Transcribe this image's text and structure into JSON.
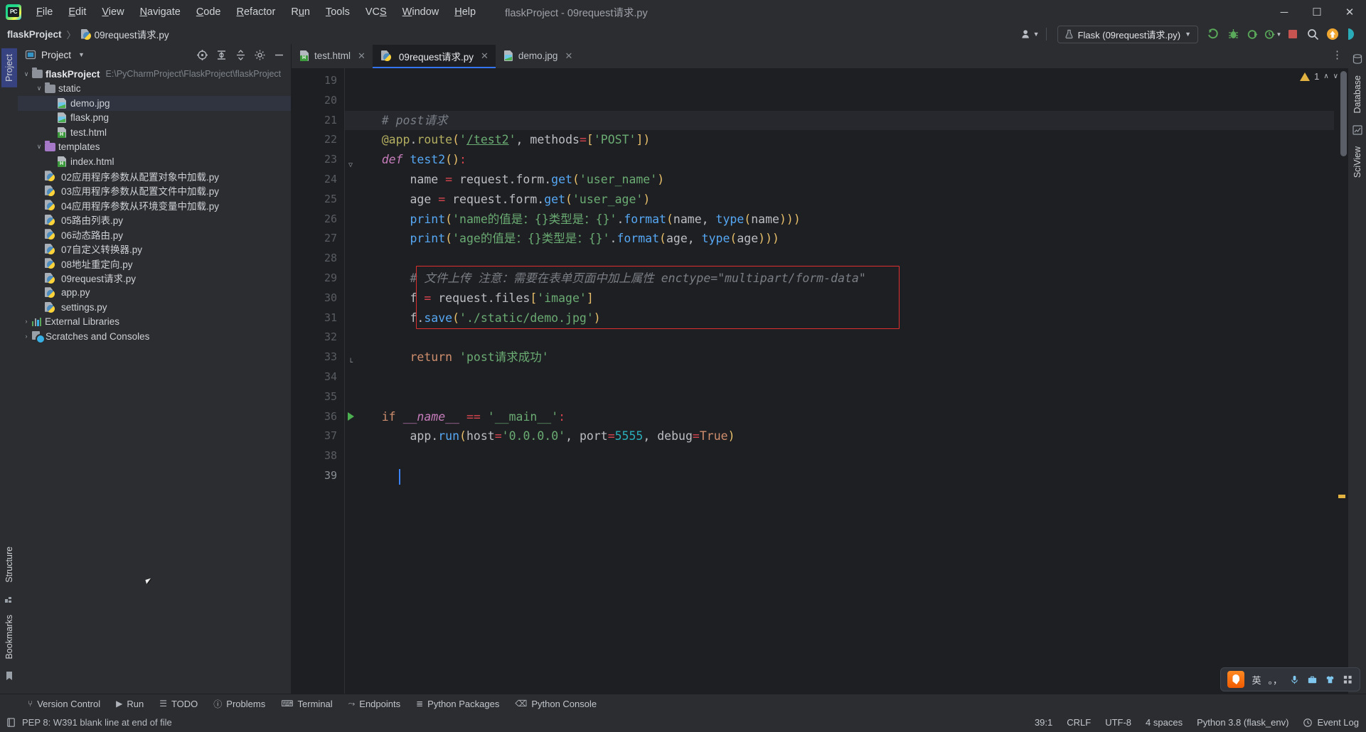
{
  "app": {
    "logo_icon": "pycharm-logo-icon",
    "window_title": "flaskProject - 09request请求.py",
    "menu": [
      {
        "mnemonic": "F",
        "rest": "ile"
      },
      {
        "mnemonic": "E",
        "rest": "dit"
      },
      {
        "mnemonic": "V",
        "rest": "iew"
      },
      {
        "mnemonic": "N",
        "rest": "avigate"
      },
      {
        "mnemonic": "C",
        "rest": "ode"
      },
      {
        "mnemonic": "R",
        "rest": "efactor"
      },
      {
        "mnemonic": "Ru",
        "rest": "n",
        "pre": true
      },
      {
        "mnemonic": "T",
        "rest": "ools"
      },
      {
        "mnemonic": "VCS",
        "rest": ""
      },
      {
        "mnemonic": "W",
        "rest": "indow"
      },
      {
        "mnemonic": "H",
        "rest": "elp"
      }
    ],
    "window_controls": {
      "minimize": "—",
      "maximize": "❐",
      "close": "✕"
    }
  },
  "breadcrumb": {
    "project": "flaskProject",
    "separator": "〉",
    "file": "09request请求.py",
    "file_icon": "python-file-icon"
  },
  "toolbar": {
    "account_icon": "user-account-icon",
    "run_config": {
      "icon": "flask-config-icon",
      "label": "Flask (09request请求.py)",
      "chevron": "▼"
    },
    "buttons": [
      {
        "name": "run-button",
        "icon": "run-icon",
        "glyph": "▶"
      },
      {
        "name": "debug-button",
        "icon": "debug-bug-icon",
        "glyph": "🐞"
      },
      {
        "name": "run-with-coverage-button",
        "icon": "coverage-icon",
        "glyph": "◑"
      },
      {
        "name": "profile-button",
        "icon": "profiler-clock-icon",
        "glyph": "◴"
      },
      {
        "name": "stop-button",
        "icon": "stop-square-icon",
        "glyph": "■"
      },
      {
        "name": "search-everywhere-button",
        "icon": "search-icon",
        "glyph": "🔍"
      },
      {
        "name": "updates-button",
        "icon": "update-arrow-icon",
        "glyph": "↑"
      },
      {
        "name": "ai-assistant-button",
        "icon": "ai-assistant-icon",
        "glyph": "◗"
      }
    ]
  },
  "left_strip": {
    "tabs": [
      {
        "label": "Project",
        "icon": "project-tab-icon",
        "active": true
      },
      {
        "label": "Structure",
        "icon": "structure-tab-icon",
        "active": false
      },
      {
        "label": "Bookmarks",
        "icon": "bookmarks-tab-icon",
        "active": false
      }
    ]
  },
  "right_strip": {
    "tabs": [
      {
        "label": "Database",
        "icon": "database-tab-icon"
      },
      {
        "label": "SciView",
        "icon": "sciview-tab-icon"
      }
    ]
  },
  "project_panel": {
    "title": "Project",
    "title_icon": "project-panel-icon",
    "chevron": "▼",
    "actions": [
      {
        "name": "select-opened-file-button",
        "icon": "crosshair-target-icon",
        "glyph": "⊕"
      },
      {
        "name": "expand-all-button",
        "icon": "expand-all-icon",
        "glyph": "⤑"
      },
      {
        "name": "collapse-all-button",
        "icon": "collapse-all-icon",
        "glyph": "⤒"
      },
      {
        "name": "settings-button",
        "icon": "gear-icon",
        "glyph": "⚙"
      },
      {
        "name": "hide-button",
        "icon": "minimize-icon",
        "glyph": "—"
      }
    ],
    "tree": [
      {
        "label": "flaskProject",
        "path": "E:\\PyCharmProject\\FlaskProject\\flaskProject",
        "icon": "folder-icon",
        "indent": 0,
        "twisty": "∨",
        "bold": true,
        "selected": false
      },
      {
        "label": "static",
        "icon": "folder-icon",
        "indent": 1,
        "twisty": "∨",
        "selected": false
      },
      {
        "label": "demo.jpg",
        "icon": "image-file-icon",
        "indent": 2,
        "twisty": "",
        "selected": true
      },
      {
        "label": "flask.png",
        "icon": "image-file-icon",
        "indent": 2,
        "twisty": "",
        "selected": false
      },
      {
        "label": "test.html",
        "icon": "html-file-icon",
        "indent": 2,
        "twisty": "",
        "selected": false
      },
      {
        "label": "templates",
        "icon": "folder-purple-icon",
        "indent": 1,
        "twisty": "∨",
        "selected": false
      },
      {
        "label": "index.html",
        "icon": "html-file-icon",
        "indent": 2,
        "twisty": "",
        "selected": false
      },
      {
        "label": "02应用程序参数从配置对象中加载.py",
        "icon": "python-file-icon",
        "indent": 1,
        "twisty": "",
        "selected": false
      },
      {
        "label": "03应用程序参数从配置文件中加载.py",
        "icon": "python-file-icon",
        "indent": 1,
        "twisty": "",
        "selected": false
      },
      {
        "label": "04应用程序参数从环境变量中加载.py",
        "icon": "python-file-icon",
        "indent": 1,
        "twisty": "",
        "selected": false
      },
      {
        "label": "05路由列表.py",
        "icon": "python-file-icon",
        "indent": 1,
        "twisty": "",
        "selected": false
      },
      {
        "label": "06动态路由.py",
        "icon": "python-file-icon",
        "indent": 1,
        "twisty": "",
        "selected": false
      },
      {
        "label": "07自定义转换器.py",
        "icon": "python-file-icon",
        "indent": 1,
        "twisty": "",
        "selected": false
      },
      {
        "label": "08地址重定向.py",
        "icon": "python-file-icon",
        "indent": 1,
        "twisty": "",
        "selected": false
      },
      {
        "label": "09request请求.py",
        "icon": "python-file-icon",
        "indent": 1,
        "twisty": "",
        "selected": false
      },
      {
        "label": "app.py",
        "icon": "python-file-icon",
        "indent": 1,
        "twisty": "",
        "selected": false
      },
      {
        "label": "settings.py",
        "icon": "python-file-icon",
        "indent": 1,
        "twisty": "",
        "selected": false
      },
      {
        "label": "External Libraries",
        "icon": "external-libraries-icon",
        "indent": 0,
        "twisty": "›",
        "selected": false
      },
      {
        "label": "Scratches and Consoles",
        "icon": "scratches-icon",
        "indent": 0,
        "twisty": "›",
        "selected": false
      }
    ]
  },
  "editor": {
    "tabs": [
      {
        "label": "test.html",
        "icon": "html-file-icon",
        "active": false,
        "close": "✕"
      },
      {
        "label": "09request请求.py",
        "icon": "python-file-icon",
        "active": true,
        "close": "✕"
      },
      {
        "label": "demo.jpg",
        "icon": "image-file-icon",
        "active": false,
        "close": "✕"
      }
    ],
    "more_tabs_icon": "more-vertical-icon",
    "first_line_number": 19,
    "lines": [
      {
        "n": 19,
        "tokens": []
      },
      {
        "n": 20,
        "tokens": []
      },
      {
        "n": 21,
        "hl": true,
        "tokens": [
          {
            "t": "    ",
            "c": "t-pl"
          },
          {
            "t": "# post请求",
            "c": "t-cmt"
          }
        ]
      },
      {
        "n": 22,
        "tokens": [
          {
            "t": "    ",
            "c": "t-pl"
          },
          {
            "t": "@app",
            "c": "t-deco"
          },
          {
            "t": ".",
            "c": "t-pl"
          },
          {
            "t": "route",
            "c": "t-deco"
          },
          {
            "t": "(",
            "c": "t-par"
          },
          {
            "t": "'",
            "c": "t-str"
          },
          {
            "t": "/test2",
            "c": "t-url"
          },
          {
            "t": "'",
            "c": "t-str"
          },
          {
            "t": ", ",
            "c": "t-pl"
          },
          {
            "t": "methods",
            "c": "t-pl"
          },
          {
            "t": "=",
            "c": "t-op"
          },
          {
            "t": "[",
            "c": "t-par"
          },
          {
            "t": "'POST'",
            "c": "t-str"
          },
          {
            "t": "]",
            "c": "t-par"
          },
          {
            "t": ")",
            "c": "t-par"
          }
        ]
      },
      {
        "n": 23,
        "fold": "▽",
        "tokens": [
          {
            "t": "    ",
            "c": "t-pl"
          },
          {
            "t": "def",
            "c": "t-kw2"
          },
          {
            "t": " ",
            "c": "t-pl"
          },
          {
            "t": "test2",
            "c": "t-def"
          },
          {
            "t": "(",
            "c": "t-par"
          },
          {
            "t": ")",
            "c": "t-par"
          },
          {
            "t": ":",
            "c": "t-op"
          }
        ]
      },
      {
        "n": 24,
        "tokens": [
          {
            "t": "        name ",
            "c": "t-pl"
          },
          {
            "t": "=",
            "c": "t-op"
          },
          {
            "t": " request.form.",
            "c": "t-pl"
          },
          {
            "t": "get",
            "c": "t-fn"
          },
          {
            "t": "(",
            "c": "t-par"
          },
          {
            "t": "'user_name'",
            "c": "t-str"
          },
          {
            "t": ")",
            "c": "t-par"
          }
        ]
      },
      {
        "n": 25,
        "tokens": [
          {
            "t": "        age ",
            "c": "t-pl"
          },
          {
            "t": "=",
            "c": "t-op"
          },
          {
            "t": " request.form.",
            "c": "t-pl"
          },
          {
            "t": "get",
            "c": "t-fn"
          },
          {
            "t": "(",
            "c": "t-par"
          },
          {
            "t": "'user_age'",
            "c": "t-str"
          },
          {
            "t": ")",
            "c": "t-par"
          }
        ]
      },
      {
        "n": 26,
        "tokens": [
          {
            "t": "        ",
            "c": "t-pl"
          },
          {
            "t": "print",
            "c": "t-fn"
          },
          {
            "t": "(",
            "c": "t-par"
          },
          {
            "t": "'name的值是：{}类型是：{}'",
            "c": "t-str"
          },
          {
            "t": ".",
            "c": "t-pl"
          },
          {
            "t": "format",
            "c": "t-fn"
          },
          {
            "t": "(",
            "c": "t-par"
          },
          {
            "t": "name, ",
            "c": "t-pl"
          },
          {
            "t": "type",
            "c": "t-fn"
          },
          {
            "t": "(",
            "c": "t-par"
          },
          {
            "t": "name",
            "c": "t-pl"
          },
          {
            "t": ")))",
            "c": "t-par"
          }
        ]
      },
      {
        "n": 27,
        "tokens": [
          {
            "t": "        ",
            "c": "t-pl"
          },
          {
            "t": "print",
            "c": "t-fn"
          },
          {
            "t": "(",
            "c": "t-par"
          },
          {
            "t": "'age的值是：{}类型是：{}'",
            "c": "t-str"
          },
          {
            "t": ".",
            "c": "t-pl"
          },
          {
            "t": "format",
            "c": "t-fn"
          },
          {
            "t": "(",
            "c": "t-par"
          },
          {
            "t": "age, ",
            "c": "t-pl"
          },
          {
            "t": "type",
            "c": "t-fn"
          },
          {
            "t": "(",
            "c": "t-par"
          },
          {
            "t": "age",
            "c": "t-pl"
          },
          {
            "t": ")))",
            "c": "t-par"
          }
        ]
      },
      {
        "n": 28,
        "tokens": []
      },
      {
        "n": 29,
        "tokens": [
          {
            "t": "        ",
            "c": "t-pl"
          },
          {
            "t": "# 文件上传 注意：需要在表单页面中加上属性 enctype=\"multipart/form-data\"",
            "c": "t-cmt"
          }
        ]
      },
      {
        "n": 30,
        "tokens": [
          {
            "t": "        f ",
            "c": "t-pl"
          },
          {
            "t": "=",
            "c": "t-op"
          },
          {
            "t": " request.files",
            "c": "t-pl"
          },
          {
            "t": "[",
            "c": "t-par"
          },
          {
            "t": "'image'",
            "c": "t-str"
          },
          {
            "t": "]",
            "c": "t-par"
          }
        ]
      },
      {
        "n": 31,
        "tokens": [
          {
            "t": "        f.",
            "c": "t-pl"
          },
          {
            "t": "save",
            "c": "t-fn"
          },
          {
            "t": "(",
            "c": "t-par"
          },
          {
            "t": "'./static/demo.jpg'",
            "c": "t-str"
          },
          {
            "t": ")",
            "c": "t-par"
          }
        ]
      },
      {
        "n": 32,
        "tokens": []
      },
      {
        "n": 33,
        "fold": "└",
        "tokens": [
          {
            "t": "        ",
            "c": "t-pl"
          },
          {
            "t": "return",
            "c": "t-kw"
          },
          {
            "t": " ",
            "c": "t-pl"
          },
          {
            "t": "'post请求成功'",
            "c": "t-str"
          }
        ]
      },
      {
        "n": 34,
        "tokens": []
      },
      {
        "n": 35,
        "tokens": []
      },
      {
        "n": 36,
        "run": true,
        "tokens": [
          {
            "t": "    ",
            "c": "t-pl"
          },
          {
            "t": "if",
            "c": "t-kw"
          },
          {
            "t": " ",
            "c": "t-pl"
          },
          {
            "t": "__name__",
            "c": "t-kw2"
          },
          {
            "t": " ",
            "c": "t-pl"
          },
          {
            "t": "==",
            "c": "t-op"
          },
          {
            "t": " ",
            "c": "t-pl"
          },
          {
            "t": "'__main__'",
            "c": "t-str"
          },
          {
            "t": ":",
            "c": "t-op"
          }
        ]
      },
      {
        "n": 37,
        "tokens": [
          {
            "t": "        app.",
            "c": "t-pl"
          },
          {
            "t": "run",
            "c": "t-fn"
          },
          {
            "t": "(",
            "c": "t-par"
          },
          {
            "t": "host",
            "c": "t-pl"
          },
          {
            "t": "=",
            "c": "t-op"
          },
          {
            "t": "'0.0.0.0'",
            "c": "t-str"
          },
          {
            "t": ", ",
            "c": "t-pl"
          },
          {
            "t": "port",
            "c": "t-pl"
          },
          {
            "t": "=",
            "c": "t-op"
          },
          {
            "t": "5555",
            "c": "t-num"
          },
          {
            "t": ", ",
            "c": "t-pl"
          },
          {
            "t": "debug",
            "c": "t-pl"
          },
          {
            "t": "=",
            "c": "t-op"
          },
          {
            "t": "True",
            "c": "t-kw"
          },
          {
            "t": ")",
            "c": "t-par"
          }
        ]
      },
      {
        "n": 38,
        "tokens": []
      },
      {
        "n": 39,
        "tokens": []
      }
    ],
    "highlight_box": {
      "from_line": 29,
      "to_line": 31,
      "color": "#e03030"
    },
    "inspection": {
      "warning_count": "1",
      "warning_icon": "warning-triangle-icon",
      "up_icon": "∧",
      "down_icon": "∨"
    }
  },
  "tool_windows": [
    {
      "label": "Version Control",
      "icon": "version-control-icon",
      "glyph": "⑂"
    },
    {
      "label": "Run",
      "icon": "run-icon",
      "glyph": "▶"
    },
    {
      "label": "TODO",
      "icon": "todo-list-icon",
      "glyph": "☰"
    },
    {
      "label": "Problems",
      "icon": "problems-icon",
      "glyph": "ⓘ"
    },
    {
      "label": "Terminal",
      "icon": "terminal-icon",
      "glyph": "⌨"
    },
    {
      "label": "Endpoints",
      "icon": "endpoints-icon",
      "glyph": "⤳"
    },
    {
      "label": "Python Packages",
      "icon": "python-packages-icon",
      "glyph": "≣"
    },
    {
      "label": "Python Console",
      "icon": "python-console-icon",
      "glyph": "⌫"
    }
  ],
  "status_bar": {
    "message_icon": "inspection-doc-icon",
    "message": "PEP 8: W391 blank line at end of file",
    "caret_position": "39:1",
    "line_separator": "CRLF",
    "encoding": "UTF-8",
    "indent": "4 spaces",
    "interpreter": "Python 3.8 (flask_env)",
    "event_log_icon": "event-log-icon",
    "event_log": "Event Log"
  },
  "ime_bar": {
    "logo_icon": "sogou-ime-icon",
    "mode": "英",
    "items": [
      {
        "icon": "punctuation-icon",
        "glyph": "。，"
      },
      {
        "icon": "microphone-icon",
        "glyph": "🎤"
      },
      {
        "icon": "toolbox-icon",
        "glyph": "🧰"
      },
      {
        "icon": "skin-icon",
        "glyph": "👗"
      },
      {
        "icon": "menu-grid-icon",
        "glyph": "☷"
      }
    ]
  }
}
